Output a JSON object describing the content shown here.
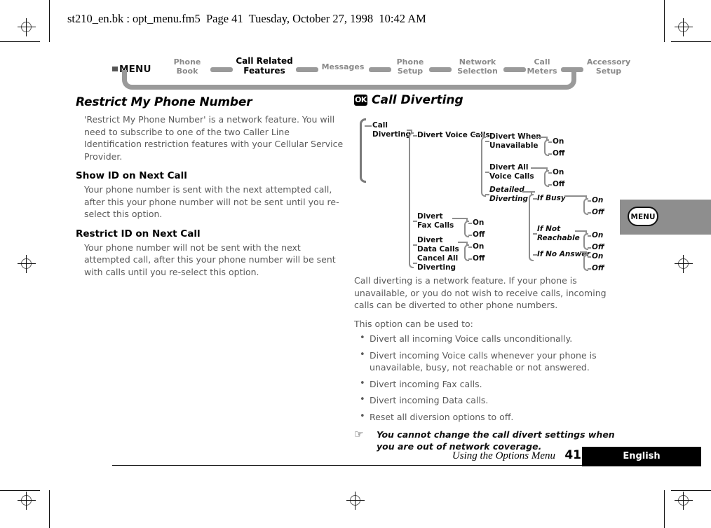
{
  "running_header": "st210_en.bk : opt_menu.fm5  Page 41  Tuesday, October 27, 1998  10:42 AM",
  "nav": {
    "menu_label": "MENU",
    "items": [
      {
        "label": "Phone\nBook",
        "active": false
      },
      {
        "label": "Call Related\nFeatures",
        "active": true
      },
      {
        "label": "Messages",
        "active": false
      },
      {
        "label": "Phone\nSetup",
        "active": false
      },
      {
        "label": "Network\nSelection",
        "active": false
      },
      {
        "label": "Call\nMeters",
        "active": false
      },
      {
        "label": "Accessory\nSetup",
        "active": false
      }
    ]
  },
  "left_column": {
    "title": "Restrict My Phone Number",
    "intro": "'Restrict My Phone Number' is a network feature. You will need to subscribe to one of the two Caller Line Identification restriction features with your Cellular Service Provider.",
    "sections": [
      {
        "heading": "Show ID on Next Call",
        "body": "Your phone number is sent with the next attempted call, after this your phone number will not be sent until you re-select this option."
      },
      {
        "heading": "Restrict ID on Next Call",
        "body": "Your phone number will not be sent with the next attempted call, after this your phone number will be sent with calls until you re-select this option."
      }
    ]
  },
  "right_column": {
    "ok_key": "OK",
    "title": "Call Diverting",
    "intro": "Call diverting is a network feature. If your phone is unavailable, or you do not wish to receive calls, incoming calls can be diverted to other phone numbers.",
    "lead_in": "This option can be used to:",
    "bullets": [
      "Divert all incoming Voice calls unconditionally.",
      "Divert incoming Voice calls whenever your phone is unavailable, busy, not reachable or not answered.",
      "Divert incoming Fax calls.",
      "Divert incoming Data calls.",
      "Reset all diversion options to off."
    ],
    "note": "You cannot change the call divert settings when you are out of network coverage.",
    "note_icon": "pointing-hand-icon"
  },
  "tree": {
    "root": "Call\nDiverting",
    "level1": [
      "Divert Voice Calls",
      "Divert\nFax Calls",
      "Divert\nData Calls",
      "Cancel All\nDiverting"
    ],
    "level2": [
      "Divert When\nUnavailable",
      "Divert All\nVoice Calls",
      "Detailed\nDiverting"
    ],
    "level3": [
      "If Busy",
      "If Not\nReachable",
      "If No Answer"
    ],
    "on_label": "On",
    "off_label": "Off"
  },
  "menu_tab": {
    "label": "MENU"
  },
  "footer": {
    "chapter": "Using the Options Menu",
    "page_number": "41",
    "language": "English"
  },
  "colors": {
    "nav_gray": "#9a9a9a",
    "body_gray": "#5a5a5a",
    "tree_gray": "#8e8e8e",
    "black": "#000000"
  }
}
